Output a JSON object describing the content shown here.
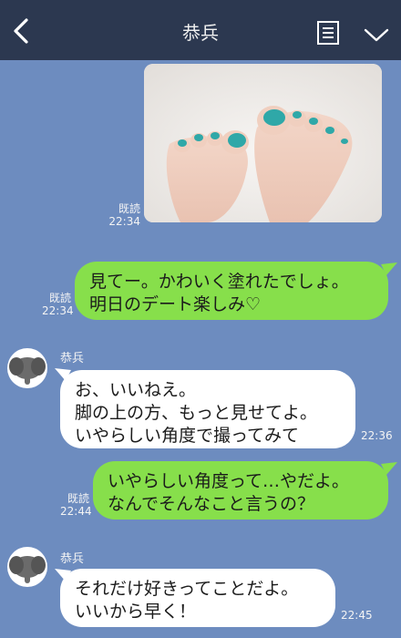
{
  "header": {
    "title": "恭兵"
  },
  "messages": [
    {
      "type": "image",
      "read": "既読",
      "time": "22:34",
      "image_desc": "pedicure-feet-photo"
    },
    {
      "type": "sent",
      "read": "既読",
      "time": "22:34",
      "lines": [
        "見てー。かわいく塗れたでしょ。",
        "明日のデート楽しみ♡"
      ]
    },
    {
      "type": "received",
      "sender": "恭兵",
      "time": "22:36",
      "lines": [
        "お、いいねえ。",
        "脚の上の方、もっと見せてよ。",
        "いやらしい角度で撮ってみて"
      ]
    },
    {
      "type": "sent",
      "read": "既読",
      "time": "22:44",
      "lines": [
        "いやらしい角度って…やだよ。",
        "なんでそんなこと言うの？"
      ]
    },
    {
      "type": "received",
      "sender": "恭兵",
      "time": "22:45",
      "lines": [
        "それだけ好きってことだよ。",
        "いいから早く！"
      ]
    }
  ],
  "colors": {
    "header": "#2c3850",
    "background": "#6d8cbf",
    "sent_bubble": "#87df4b",
    "received_bubble": "#ffffff"
  }
}
